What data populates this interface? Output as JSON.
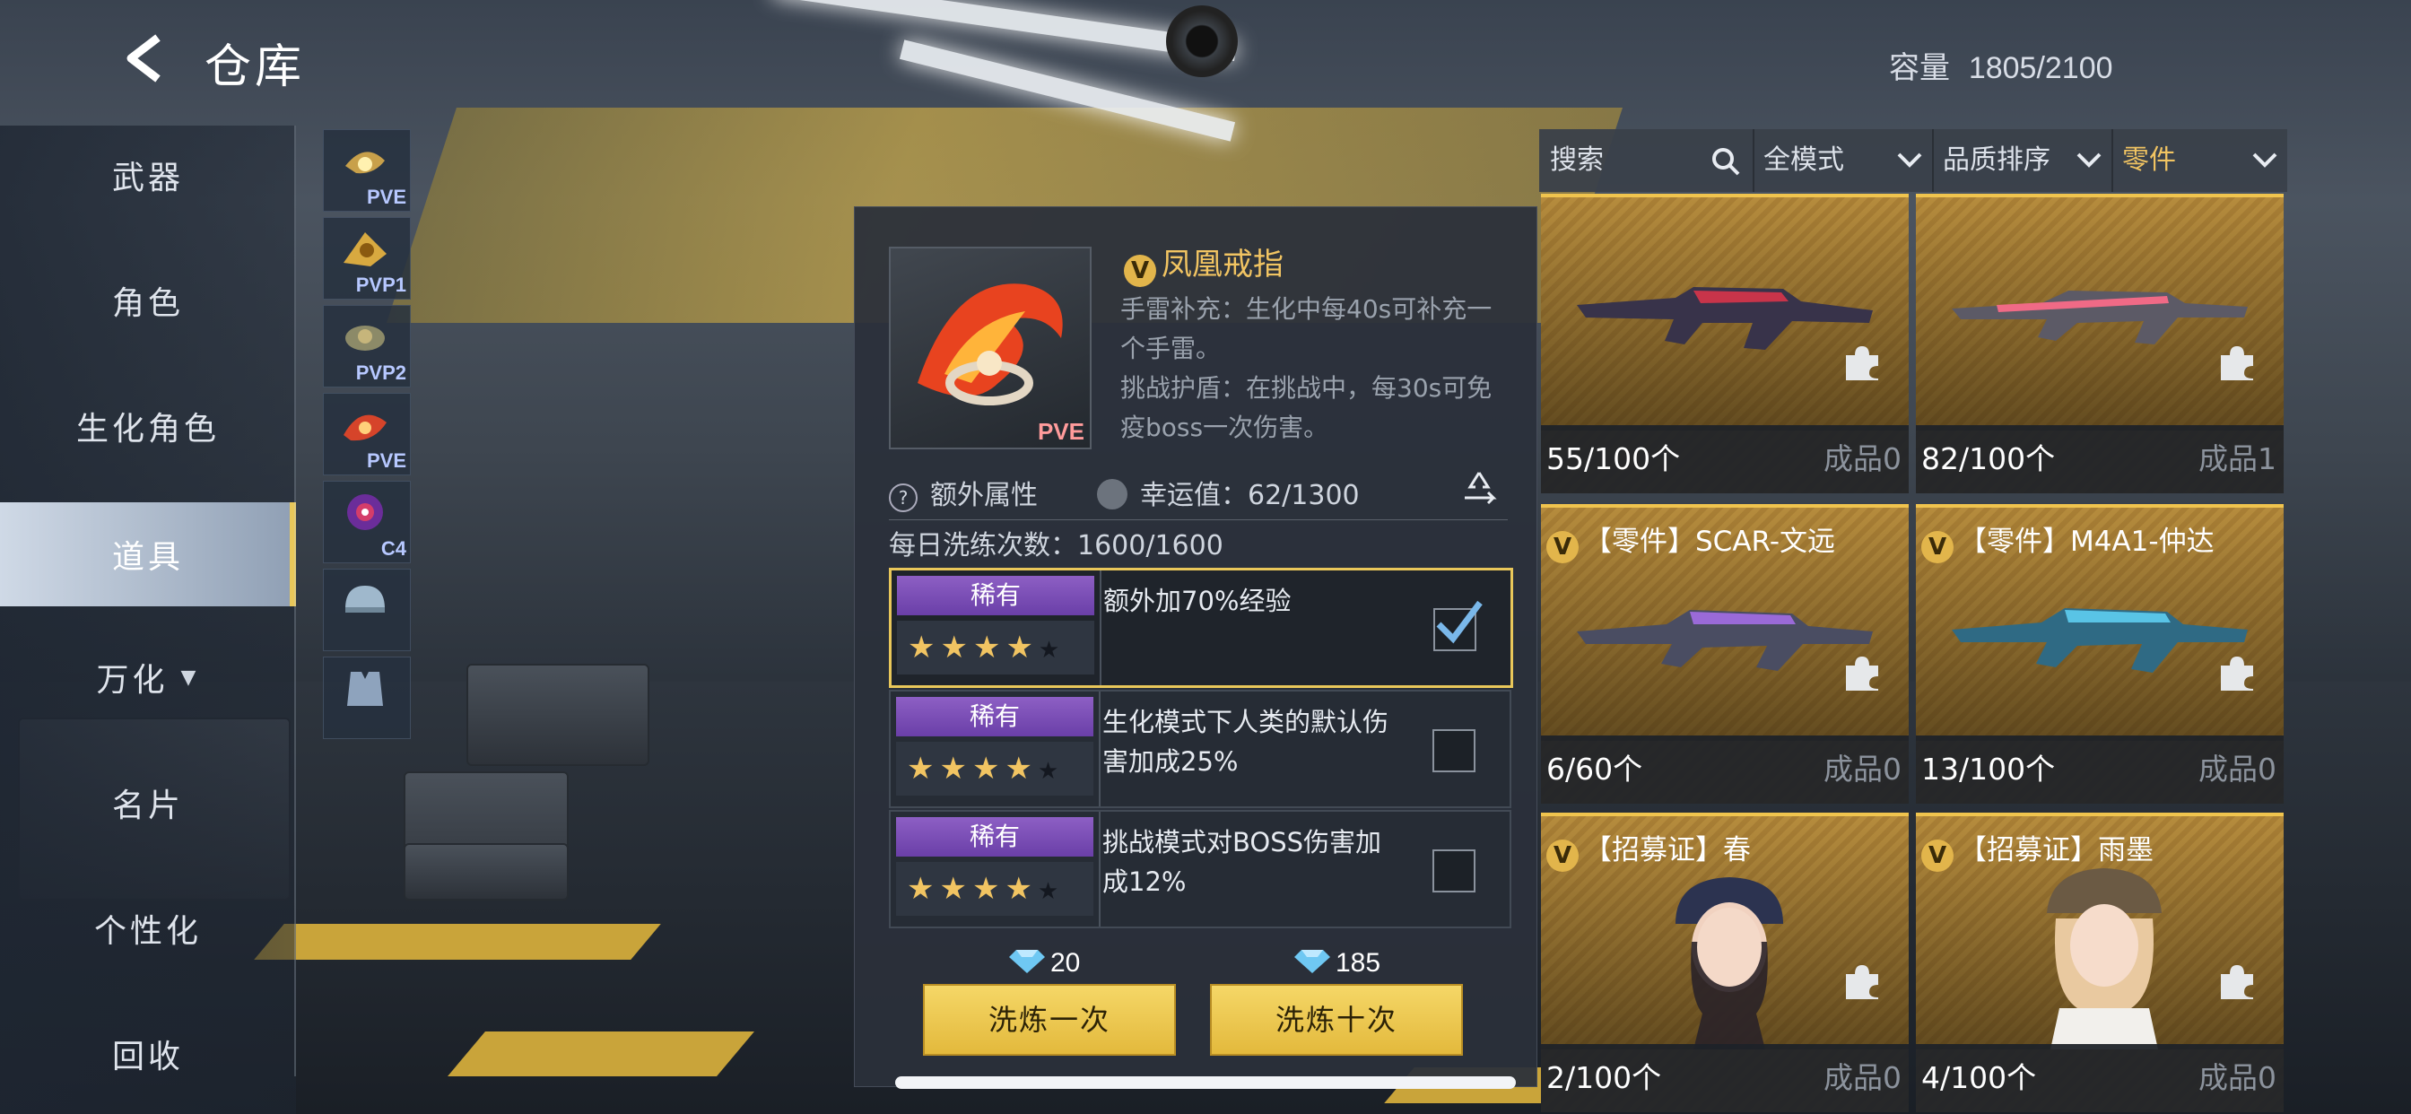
{
  "header": {
    "title": "仓库",
    "capacity_label": "容量",
    "capacity_value": "1805/2100"
  },
  "nav": {
    "items": [
      {
        "label": "武器"
      },
      {
        "label": "角色"
      },
      {
        "label": "生化角色"
      },
      {
        "label": "道具"
      },
      {
        "label": "万化"
      },
      {
        "label": "名片"
      },
      {
        "label": "个性化"
      },
      {
        "label": "回收"
      }
    ],
    "active": "道具"
  },
  "thumbs": [
    {
      "label": "PVE",
      "icon": "ring-icon"
    },
    {
      "label": "PVP1",
      "icon": "ring-icon"
    },
    {
      "label": "PVP2",
      "icon": "ring-icon"
    },
    {
      "label": "PVE",
      "icon": "ring-icon"
    },
    {
      "label": "C4",
      "icon": "c4-icon"
    },
    {
      "label": "",
      "icon": "helmet-icon"
    },
    {
      "label": "",
      "icon": "vest-icon"
    }
  ],
  "detail": {
    "item_badge": "Ⅴ",
    "item_name": "凤凰戒指",
    "item_tag": "PVE",
    "desc_1": "手雷补充：生化中每40s可补充一个手雷。",
    "desc_2": "挑战护盾：在挑战中，每30s可免疫boss一次伤害。",
    "extra_attr_label": "额外属性",
    "luck_label": "幸运值：62/1300",
    "wash_count": "每日洗练次数：1600/1600",
    "options": [
      {
        "rarity": "稀有",
        "stars": "★★★★",
        "text": "额外加70%经验",
        "checked": true
      },
      {
        "rarity": "稀有",
        "stars": "★★★★",
        "text": "生化模式下人类的默认伤害加成25%",
        "checked": false
      },
      {
        "rarity": "稀有",
        "stars": "★★★★",
        "text": "挑战模式对BOSS伤害加成12%",
        "checked": false
      }
    ],
    "cost_once": "20",
    "cost_ten": "185",
    "btn_once": "洗炼一次",
    "btn_ten": "洗炼十次"
  },
  "filters": {
    "search_placeholder": "搜索",
    "mode": "全模式",
    "sort": "品质排序",
    "category": "零件"
  },
  "cards": [
    {
      "title": "",
      "count": "55/100个",
      "product": "成品0",
      "kind": "rifle-dark"
    },
    {
      "title": "",
      "count": "82/100个",
      "product": "成品1",
      "kind": "rifle-pink"
    },
    {
      "title": "【零件】SCAR-文远",
      "count": "6/60个",
      "product": "成品0",
      "kind": "rifle-purple"
    },
    {
      "title": "【零件】M4A1-仲达",
      "count": "13/100个",
      "product": "成品0",
      "kind": "rifle-blue"
    },
    {
      "title": "【招募证】春",
      "count": "2/100个",
      "product": "成品0",
      "kind": "character"
    },
    {
      "title": "【招募证】雨墨",
      "count": "4/100个",
      "product": "成品0",
      "kind": "character"
    }
  ],
  "colors": {
    "accent": "#f1c462",
    "rare": "#7a4db6",
    "card": "#b68c3d",
    "button": "#f0cd58"
  }
}
